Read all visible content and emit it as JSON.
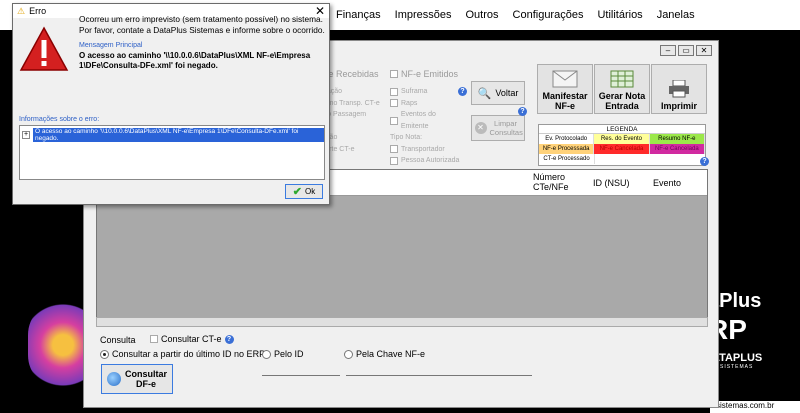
{
  "menu": [
    "Finanças",
    "Impressões",
    "Outros",
    "Configurações",
    "Utilitários",
    "Janelas"
  ],
  "brand": {
    "line1": "aPlus",
    "line2": "RP",
    "line3": "DATAPLUS",
    "line4": "SISTEMAS",
    "site": "sistemas.com.br"
  },
  "window": {
    "tabs": {
      "received": "F-e Recebidas",
      "issued": "NF-e Emitidos"
    },
    "col1": [
      "ifestação",
      "resumo Transp. CT-e",
      "gistro Passagem",
      "F-e",
      "ortação",
      "nsporte CT-e"
    ],
    "col2": [
      "Suframa",
      "Raps",
      "Eventos do Emitente",
      "Tipo Nota:",
      "Transportador",
      "Pessoa Autorizada"
    ],
    "buttons": {
      "voltar": "Voltar",
      "limpar": "Limpar Consultas",
      "manifestar": "Manifestar NF-e",
      "gerar": "Gerar Nota Entrada",
      "imprimir": "Imprimir"
    },
    "legend": {
      "title": "LEGENDA",
      "rows": [
        [
          "Ev. Protocolado",
          "Res. do Evento",
          "Resumo NF-e"
        ],
        [
          "NF-e Processada",
          "NF-e Cancelada",
          "NF-e Cancelada"
        ],
        [
          "CT-e Processado",
          "",
          ""
        ]
      ],
      "colors": [
        "#ffffff",
        "#ffff99",
        "#9be84a",
        "#ffd27a",
        "#ff2a2a",
        "#d12aa0"
      ]
    },
    "grid_headers": [
      "Número CTe/NFe",
      "ID (NSU)",
      "Evento"
    ],
    "consulta": {
      "label": "Consulta",
      "consultar_cte": "Consultar CT-e",
      "opt1": "Consultar a partir do último ID no ERP",
      "opt2": "Pelo ID",
      "opt3": "Pela Chave NF-e",
      "button": "Consultar DF-e"
    }
  },
  "dialog": {
    "title": "Erro",
    "message": "Ocorreu um erro imprevisto (sem tratamento possível) no sistema. Por favor, contate a DataPlus Sistemas e informe sobre o ocorrido.",
    "main_label": "Mensagem Principal",
    "main_message": "O acesso ao caminho '\\\\10.0.0.6\\DataPlus\\XML NF-e\\Empresa 1\\DFe\\Consulta-DFe.xml' foi negado.",
    "info_label": "Informações sobre o erro:",
    "tree_item": "O acesso ao caminho '\\\\10.0.0.6\\DataPlus\\XML NF-e\\Empresa 1\\DFe\\Consulta-DFe.xml' foi negado.",
    "ok": "Ok"
  }
}
